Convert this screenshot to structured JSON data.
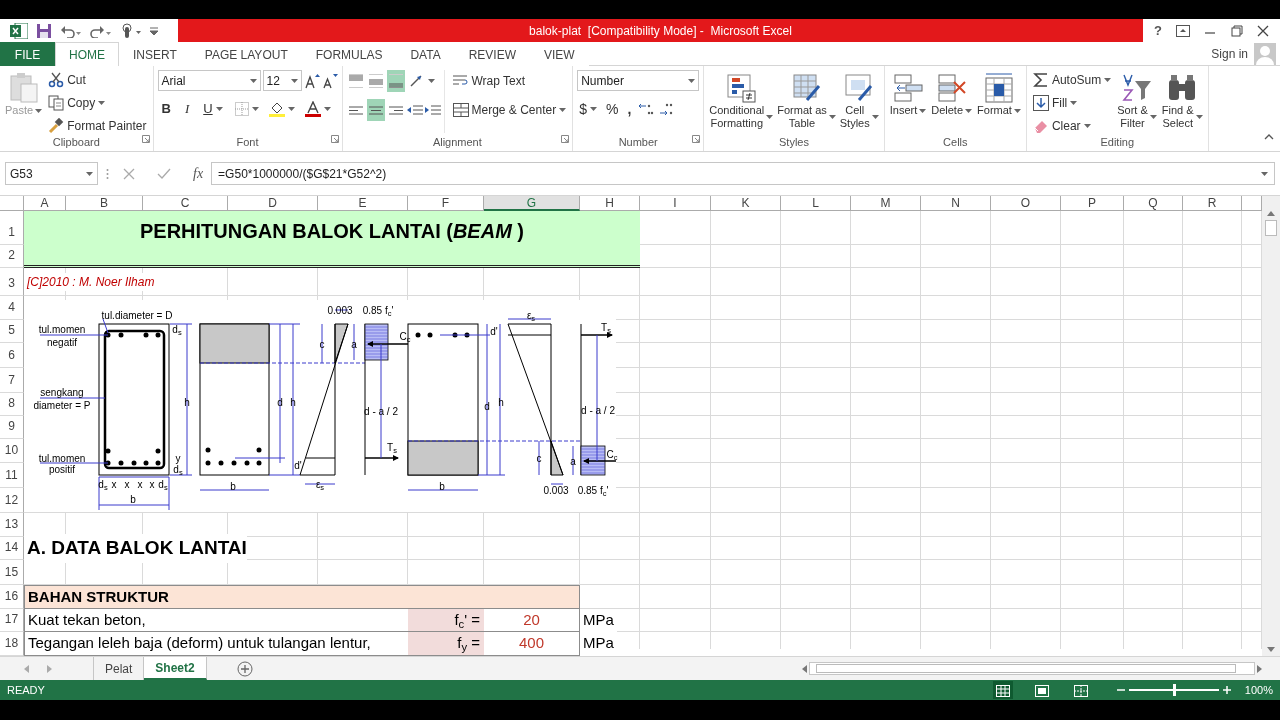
{
  "title_bar": {
    "title": "balok-plat  [Compatibility Mode] -  Microsoft Excel",
    "help": "?",
    "sign_in": "Sign in"
  },
  "ribbon_tabs": [
    {
      "label": "FILE",
      "kind": "file",
      "selected": false
    },
    {
      "label": "HOME",
      "kind": "tab",
      "selected": true
    },
    {
      "label": "INSERT",
      "kind": "tab",
      "selected": false
    },
    {
      "label": "PAGE LAYOUT",
      "kind": "tab",
      "selected": false
    },
    {
      "label": "FORMULAS",
      "kind": "tab",
      "selected": false
    },
    {
      "label": "DATA",
      "kind": "tab",
      "selected": false
    },
    {
      "label": "REVIEW",
      "kind": "tab",
      "selected": false
    },
    {
      "label": "VIEW",
      "kind": "tab",
      "selected": false
    }
  ],
  "ribbon_groups": [
    {
      "kind": "clipboard",
      "title": "Clipboard",
      "paste": {
        "label": "Paste",
        "disabled": true
      },
      "items": [
        "Cut",
        "Copy",
        "Format Painter"
      ]
    },
    {
      "kind": "font",
      "title": "Font",
      "font_name": "Arial",
      "font_size": "12",
      "styles": [
        "B",
        "I",
        "U"
      ]
    },
    {
      "kind": "alignment",
      "title": "Alignment",
      "vertical": [
        {
          "selected": false
        },
        {
          "selected": false
        },
        {
          "selected": true
        }
      ],
      "horizontal": [
        {
          "selected": false
        },
        {
          "selected": true
        },
        {
          "selected": false
        }
      ],
      "wrap": "Wrap Text",
      "merge": "Merge & Center"
    },
    {
      "kind": "number",
      "title": "Number",
      "format": "Number",
      "symbols": [
        "$",
        "%",
        ","
      ]
    },
    {
      "kind": "styles",
      "title": "Styles",
      "buttons": [
        "Conditional\nFormatting",
        "Format as\nTable",
        "Cell\nStyles"
      ]
    },
    {
      "kind": "cells",
      "title": "Cells",
      "buttons": [
        "Insert",
        "Delete",
        "Format"
      ]
    },
    {
      "kind": "editing",
      "title": "Editing",
      "items": [
        "AutoSum",
        "Fill",
        "Clear"
      ],
      "buttons": [
        "Sort &\nFilter",
        "Find &\nSelect"
      ]
    }
  ],
  "formula_bar": {
    "name_box": "G53",
    "function_label": "fx",
    "formula": "=G50*1000000/($G$21*G52^2)"
  },
  "columns": [
    {
      "label": "A",
      "selected": false
    },
    {
      "label": "B",
      "selected": false
    },
    {
      "label": "C",
      "selected": false
    },
    {
      "label": "D",
      "selected": false
    },
    {
      "label": "E",
      "selected": false
    },
    {
      "label": "F",
      "selected": false
    },
    {
      "label": "G",
      "selected": true
    },
    {
      "label": "H",
      "selected": false
    },
    {
      "label": "I",
      "selected": false
    },
    {
      "label": "K",
      "selected": false
    },
    {
      "label": "L",
      "selected": false
    },
    {
      "label": "M",
      "selected": false
    },
    {
      "label": "N",
      "selected": false
    },
    {
      "label": "O",
      "selected": false
    },
    {
      "label": "P",
      "selected": false
    },
    {
      "label": "Q",
      "selected": false
    },
    {
      "label": "R",
      "selected": false
    }
  ],
  "rows": [
    "1",
    "2",
    "3",
    "4",
    "5",
    "6",
    "7",
    "8",
    "9",
    "10",
    "11",
    "12",
    "13",
    "14",
    "15",
    "16",
    "17",
    "18"
  ],
  "sheet": {
    "title": "PERHITUNGAN BALOK LANTAI (*BEAM* )",
    "credit": "[C]2010 : M. Noer Ilham",
    "diagram_labels": [
      "tul.diameter = D",
      "tul.momen",
      "negatif",
      "sengkang",
      "diameter = P",
      "tul.momen",
      "positif",
      "d$_{s}$",
      "h",
      "y",
      "d$_{s}$",
      "d$_{s}$",
      "x",
      "x",
      "x",
      "x",
      "d$_{s}$",
      "b",
      "d",
      "h",
      "d'",
      "b",
      "0.003",
      "c",
      "ε$_{s}$",
      "0.85 f$_{c}$'",
      "a",
      "C$_{c}$",
      "d - a / 2",
      "T$_{s}$",
      "d'",
      "d",
      "h",
      "b",
      "ε$_{s}$",
      "c",
      "0.003",
      "T$_{s}$",
      "d - a / 2",
      "a",
      "C$_{c}$",
      "0.85 f$_{c}$'"
    ],
    "section_heading": "A. DATA BALOK LANTAI",
    "group_heading": "BAHAN STRUKTUR",
    "params": [
      {
        "label": "Kuat tekan beton,",
        "symbol": "f$_{c}$' =",
        "value": "20",
        "unit": "MPa"
      },
      {
        "label": "Tegangan leleh baja (deform) untuk tulangan lentur,",
        "symbol": "f$_{y}$ =",
        "value": "400",
        "unit": "MPa"
      }
    ]
  },
  "sheet_tabs": [
    {
      "label": "Pelat",
      "selected": false
    },
    {
      "label": "Sheet2",
      "selected": true
    }
  ],
  "status_bar": {
    "text": "READY",
    "views": [
      {
        "selected": true
      },
      {
        "selected": false
      },
      {
        "selected": false
      }
    ],
    "zoom_slider": {
      "level": 0.5
    },
    "zoom": "100%"
  }
}
